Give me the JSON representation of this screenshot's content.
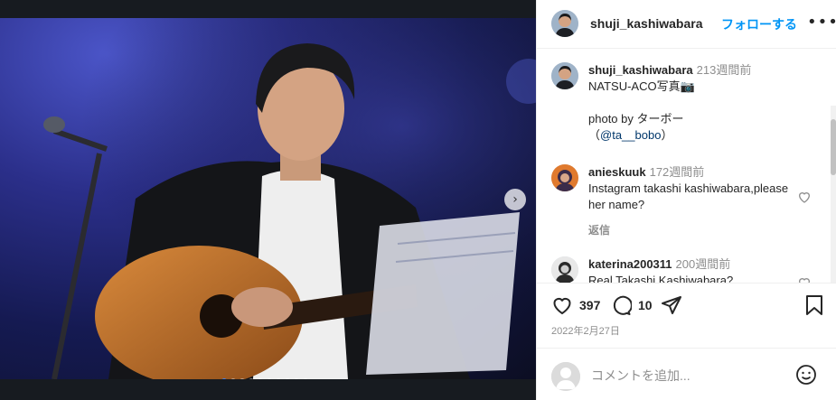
{
  "post": {
    "username": "shuji_kashiwabara",
    "follow_label": "フォローする",
    "more_label": "•••",
    "caption_time": "213週間前",
    "caption_line1": "NATSU-ACO写真📷",
    "caption_line2": "photo by ターボー",
    "caption_open": "（",
    "caption_mention": "@ta__bobo",
    "caption_close": "）"
  },
  "comments": [
    {
      "username": "anieskuuk",
      "time": "172週間前",
      "text": "Instagram takashi kashiwabara,please her name?",
      "reply_label": "返信"
    },
    {
      "username": "katerina200311",
      "time": "200週間前",
      "text": "Real Takashi Kashiwabara?"
    }
  ],
  "actions": {
    "likes": "397",
    "comments": "10"
  },
  "date": "2022年2月27日",
  "add_comment": {
    "placeholder": "コメントを追加..."
  },
  "carousel": {
    "slides": 10,
    "active": 1,
    "next_glyph": "›"
  },
  "colors": {
    "accent": "#0095f6",
    "stage_blue": "#2b2f8a",
    "text": "#262626",
    "muted": "#8e8e8e"
  }
}
